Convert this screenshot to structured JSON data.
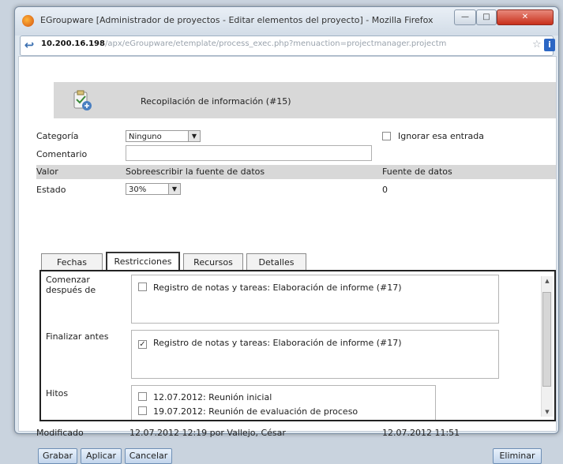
{
  "window": {
    "title": "EGroupware [Administrador de proyectos - Editar elementos del proyecto] - Mozilla Firefox",
    "min_label": "—",
    "max_label": "□",
    "close_label": "✕"
  },
  "address_bar": {
    "host": "10.200.16.198",
    "path": "/apx/eGroupware/etemplate/process_exec.php?menuaction=projectmanager.projectm"
  },
  "record": {
    "title": "Recopilación de información (#15)"
  },
  "form": {
    "categoria_label": "Categoría",
    "categoria_value": "Ninguno",
    "ignorar_label": "Ignorar esa entrada",
    "comentario_label": "Comentario",
    "comentario_value": "",
    "valor_label": "Valor",
    "sobreescribir_label": "Sobreescribir la fuente de datos",
    "fuente_label": "Fuente de datos",
    "estado_label": "Estado",
    "estado_value": "30%",
    "fuente_value": "0"
  },
  "tabs": [
    {
      "label": "Fechas"
    },
    {
      "label": "Restricciones"
    },
    {
      "label": "Recursos"
    },
    {
      "label": "Detalles"
    }
  ],
  "restricciones": {
    "comenzar_label": "Comenzar después de",
    "comenzar_items": [
      {
        "label": "Registro de notas y tareas: Elaboración de informe (#17)",
        "checked": false
      }
    ],
    "finalizar_label": "Finalizar antes",
    "finalizar_items": [
      {
        "label": "Registro de notas y tareas: Elaboración de informe (#17)",
        "checked": true
      }
    ],
    "hitos_label": "Hitos",
    "hitos_items": [
      {
        "label": "12.07.2012: Reunión inicial",
        "checked": false
      },
      {
        "label": "19.07.2012: Reunión de evaluación de proceso",
        "checked": false
      }
    ]
  },
  "footer": {
    "modificado_label": "Modificado",
    "modificado_value": "12.07.2012 12:19 por Vallejo, César",
    "creado_value": "12.07.2012 11:51"
  },
  "buttons": {
    "grabar": "Grabar",
    "aplicar": "Aplicar",
    "cancelar": "Cancelar",
    "eliminar": "Eliminar"
  }
}
